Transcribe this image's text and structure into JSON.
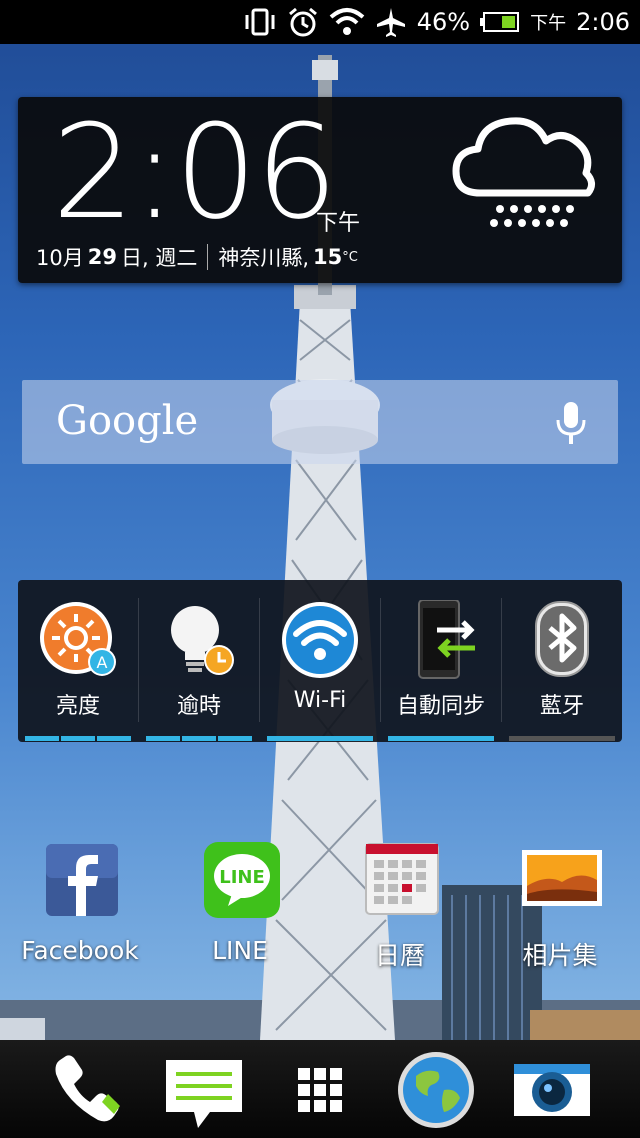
{
  "status_bar": {
    "battery_percent": "46%",
    "ampm": "下午",
    "time": "2:06",
    "icons": [
      "vibrate-icon",
      "alarm-icon",
      "wifi-icon",
      "airplane-icon",
      "battery-icon"
    ]
  },
  "clock_widget": {
    "time": "2:06",
    "ampm": "下午",
    "date_prefix": "10月",
    "date_day": "29",
    "date_suffix": "日, 週二",
    "location": "神奈川縣,",
    "temperature": "15",
    "temp_unit": "°C",
    "weather_icon": "rain-cloud-icon"
  },
  "search": {
    "logo": "Google",
    "mic_icon": "mic-icon"
  },
  "quick_settings": [
    {
      "label": "亮度",
      "icon": "brightness-icon",
      "bar_color": "#33b5e5"
    },
    {
      "label": "逾時",
      "icon": "timeout-bulb-icon",
      "bar_color": "#33b5e5"
    },
    {
      "label": "Wi-Fi",
      "icon": "wifi-icon",
      "bar_color": "#33b5e5"
    },
    {
      "label": "自動同步",
      "icon": "sync-icon",
      "bar_color": "#33b5e5"
    },
    {
      "label": "藍牙",
      "icon": "bluetooth-icon",
      "bar_color": "#555555"
    }
  ],
  "apps": [
    {
      "label": "Facebook",
      "icon": "facebook-icon"
    },
    {
      "label": "LINE",
      "icon": "line-icon"
    },
    {
      "label": "日曆",
      "icon": "calendar-icon"
    },
    {
      "label": "相片集",
      "icon": "gallery-icon"
    }
  ],
  "dock": [
    {
      "icon": "phone-icon"
    },
    {
      "icon": "messages-icon"
    },
    {
      "icon": "app-drawer-icon"
    },
    {
      "icon": "browser-globe-icon"
    },
    {
      "icon": "camera-icon"
    }
  ],
  "colors": {
    "accent": "#33b5e5",
    "widget_bg": "#0a0a0a"
  }
}
